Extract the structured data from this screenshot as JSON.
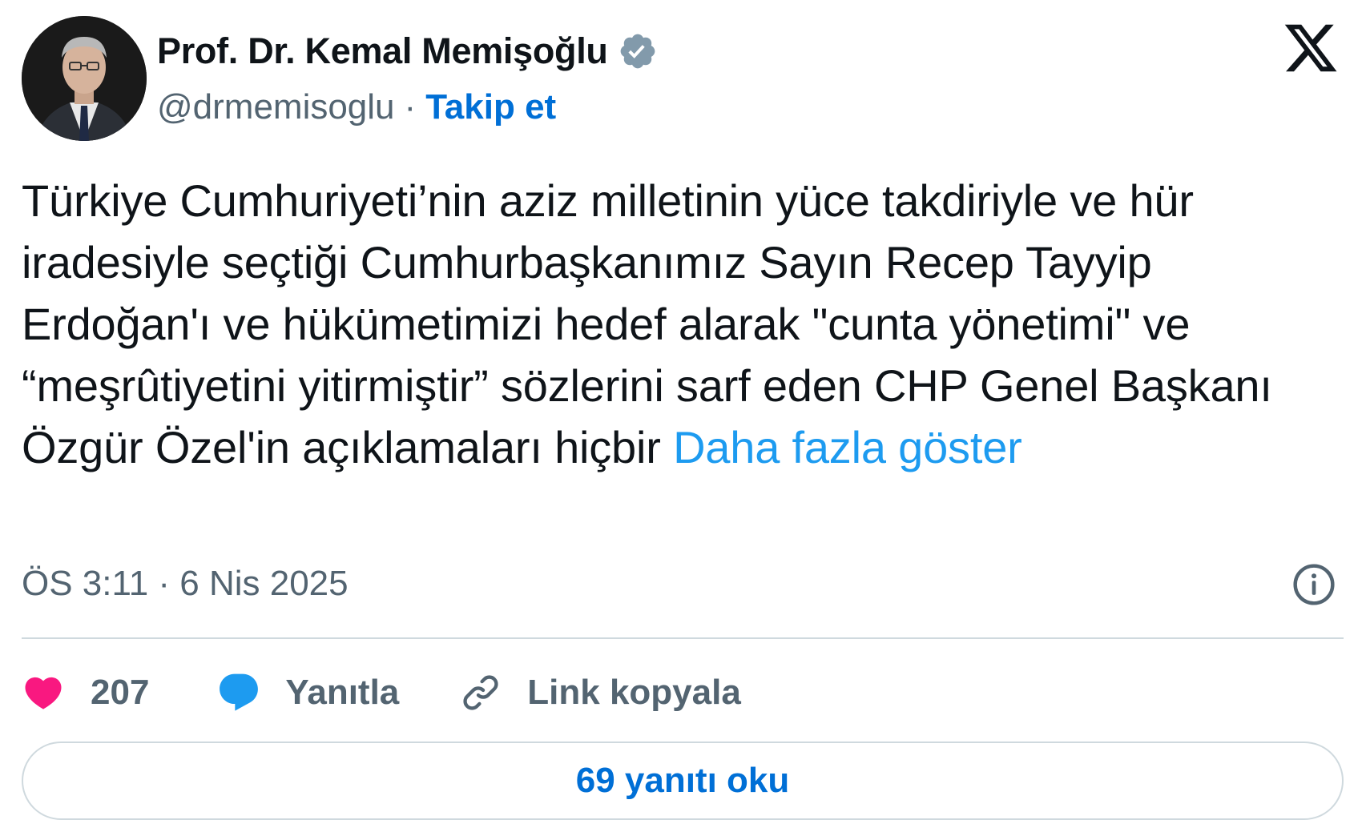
{
  "author": {
    "display_name": "Prof. Dr. Kemal Memişoğlu",
    "handle": "@drmemisoglu",
    "separator": "·",
    "follow_label": "Takip et",
    "verified": true,
    "badge_color": "#829aab"
  },
  "tweet": {
    "text": "Türkiye Cumhuriyeti’nin aziz milletinin yüce takdiriyle ve hür iradesiyle seçtiği Cumhurbaşkanımız Sayın Recep Tayyip Erdoğan'ı ve hükümetimizi hedef alarak \"cunta yönetimi\" ve “meşrûtiyetini yitirmiştir” sözlerini sarf eden CHP Genel Başkanı Özgür Özel'in açıklamaları hiçbir",
    "show_more_label": "Daha fazla göster",
    "timestamp": "ÖS 3:11 · 6 Nis 2025"
  },
  "actions": {
    "like_count": "207",
    "reply_label": "Yanıtla",
    "copy_link_label": "Link kopyala"
  },
  "replies_button_label": "69 yanıtı oku",
  "icons": {
    "x_logo": "x-logo-icon",
    "verified": "verified-badge-icon",
    "info": "info-icon",
    "like": "heart-icon",
    "reply": "speech-bubble-icon",
    "copy": "link-icon"
  },
  "colors": {
    "link_blue": "#1d9bf0",
    "follow_blue": "#006fd6",
    "like_pink": "#f91880",
    "secondary_text": "#536471",
    "border": "#cfd9de"
  }
}
